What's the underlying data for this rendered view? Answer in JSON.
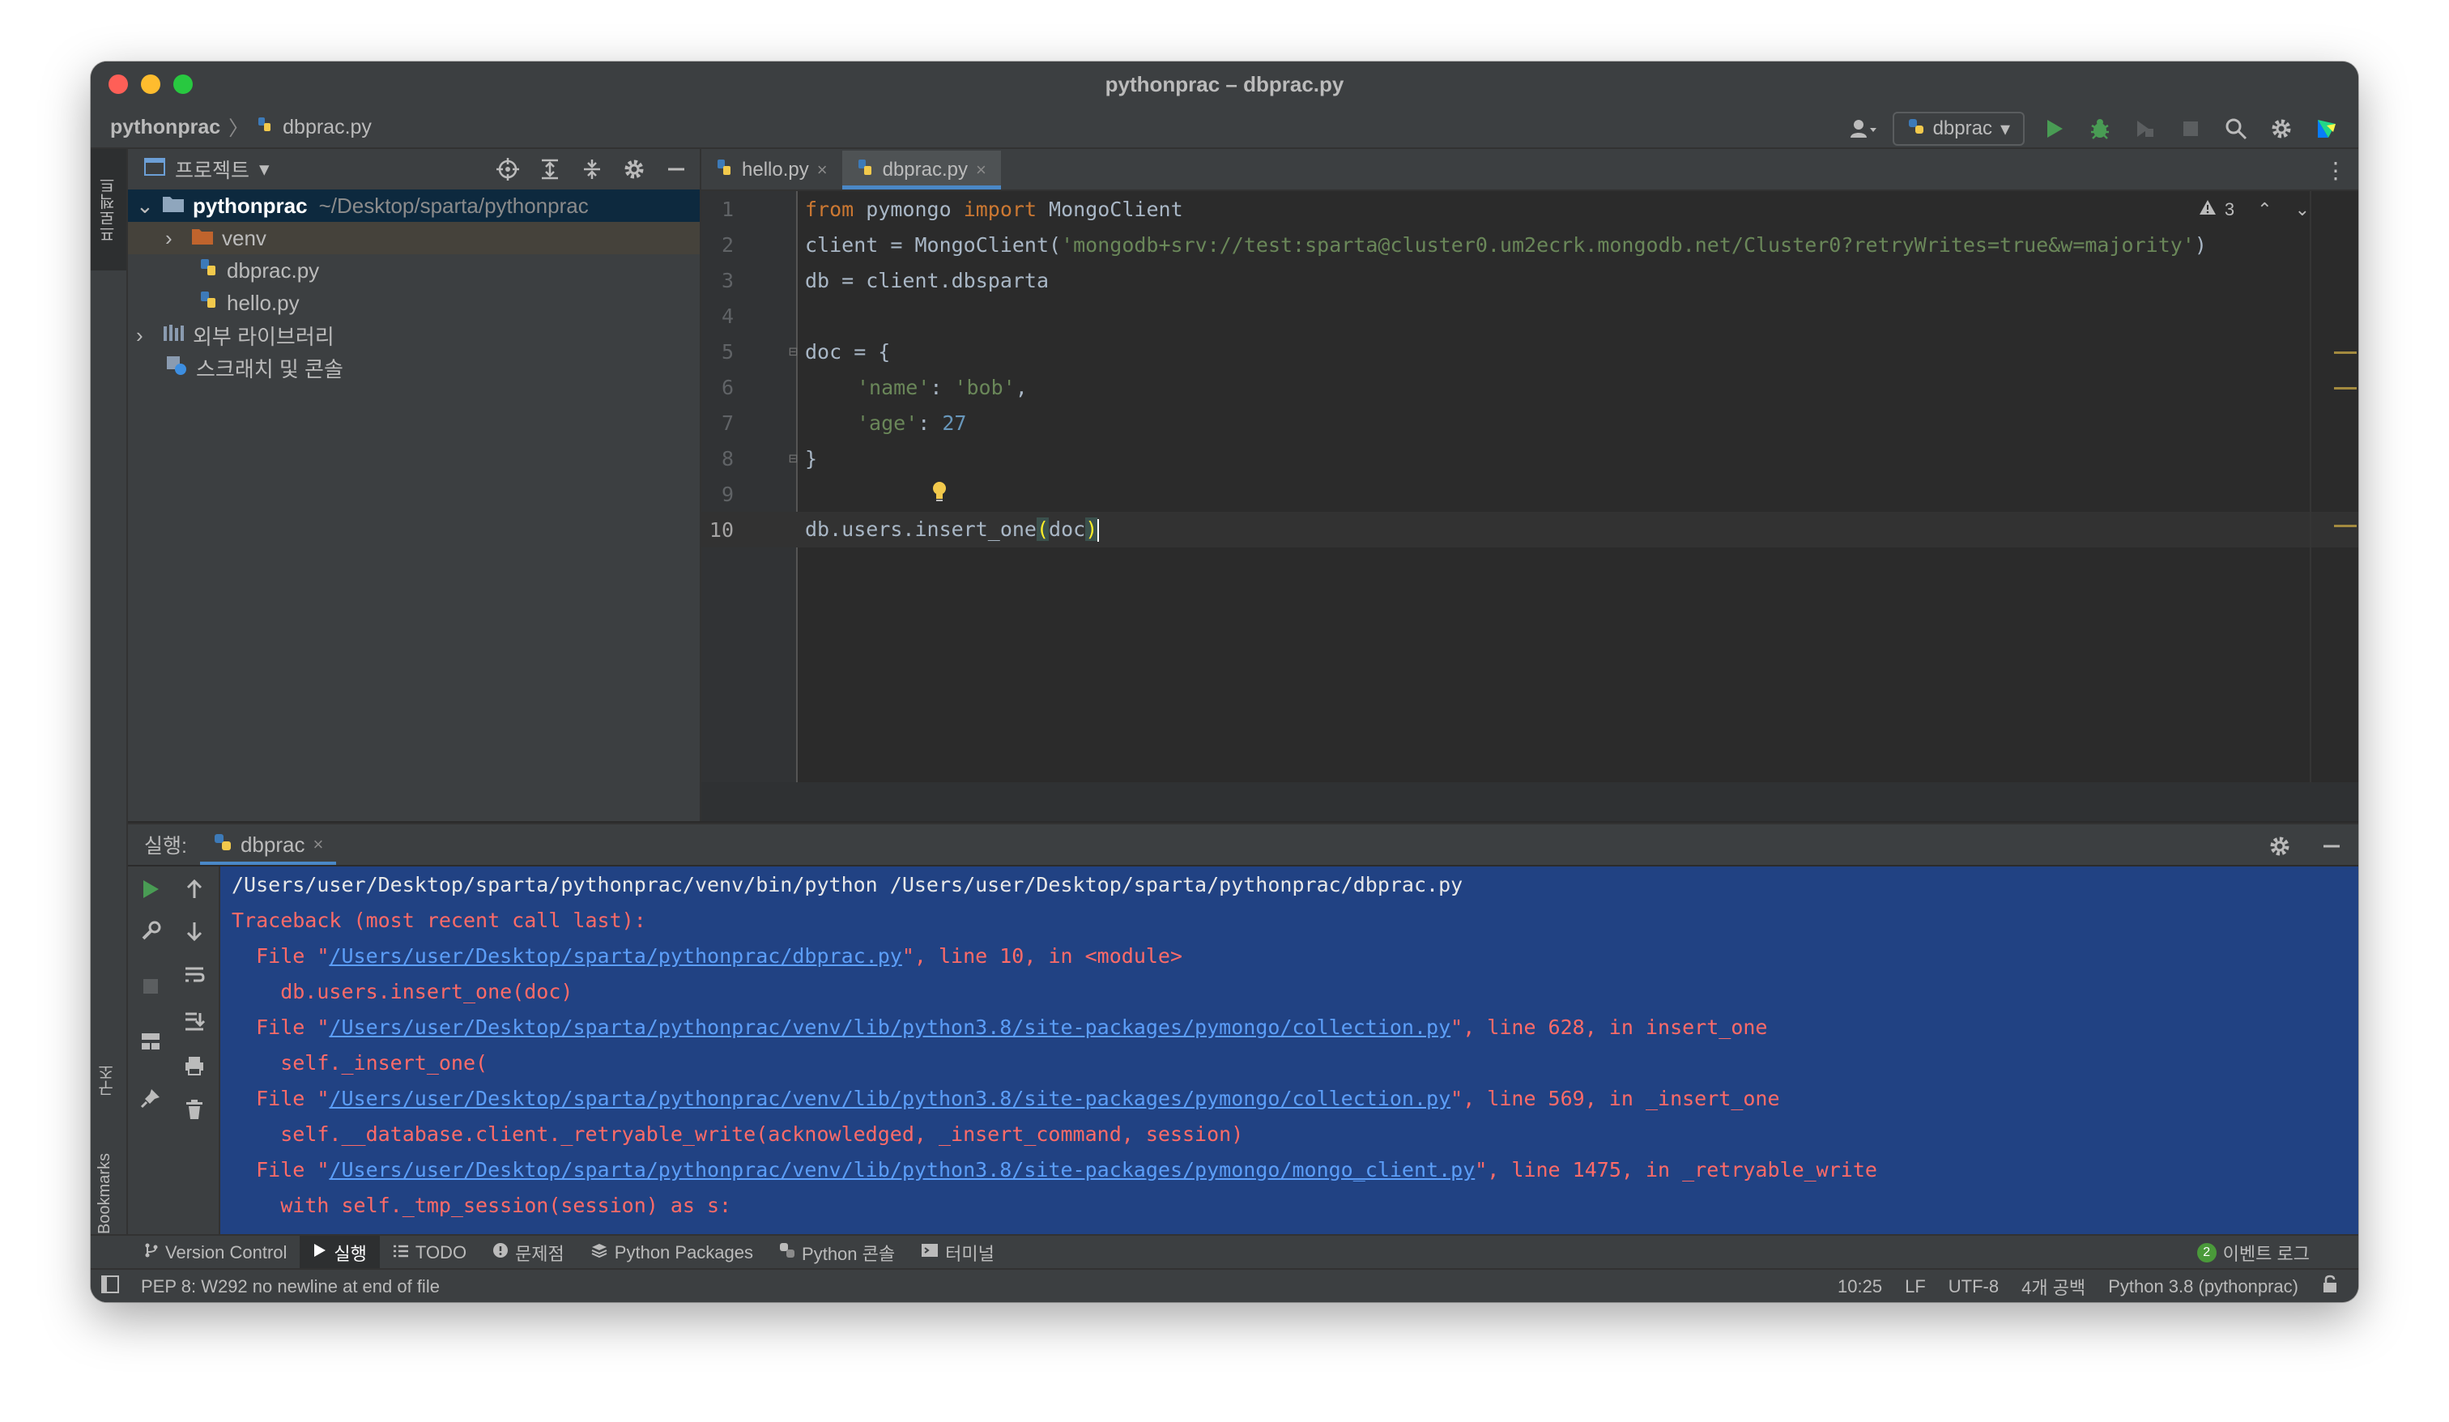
{
  "window": {
    "title": "pythonprac – dbprac.py"
  },
  "navbar": {
    "crumbs": [
      "pythonprac",
      "dbprac.py"
    ],
    "run_config": "dbprac"
  },
  "left_stripe": {
    "project_label": "프로젝트",
    "structure_label": "구조",
    "bookmarks_label": "Bookmarks"
  },
  "project_panel": {
    "title": "프로젝트",
    "root": {
      "name": "pythonprac",
      "path": "~/Desktop/sparta/pythonprac"
    },
    "items": [
      {
        "name": "venv",
        "icon": "folder-icon"
      },
      {
        "name": "dbprac.py",
        "icon": "python-file-icon"
      },
      {
        "name": "hello.py",
        "icon": "python-file-icon"
      },
      {
        "name": "외부 라이브러리",
        "icon": "library-icon"
      },
      {
        "name": "스크래치 및 콘솔",
        "icon": "scratch-icon"
      }
    ]
  },
  "editor": {
    "tabs": [
      {
        "label": "hello.py",
        "active": false
      },
      {
        "label": "dbprac.py",
        "active": true
      }
    ],
    "warning_count": "3",
    "line_numbers": [
      "1",
      "2",
      "3",
      "4",
      "5",
      "6",
      "7",
      "8",
      "9",
      "10"
    ],
    "code": {
      "l1": {
        "kw1": "from",
        "t1": " pymongo ",
        "kw2": "import",
        "t2": " MongoClient"
      },
      "l2": {
        "t1": "client = MongoClient(",
        "s1": "'mongodb+srv://test:sparta@cluster0.um2ecrk.mongodb.net/Cluster0?retryWrites=true&w=majority'",
        "t2": ")"
      },
      "l3": {
        "t1": "db = client.dbsparta"
      },
      "l5": {
        "t1": "doc = {"
      },
      "l6": {
        "s1": "'name'",
        "t1": ": ",
        "s2": "'bob'",
        "t2": ","
      },
      "l7": {
        "s1": "'age'",
        "t1": ": ",
        "n1": "27"
      },
      "l8": {
        "t1": "}"
      },
      "l10": {
        "t1": "db.users.insert_one",
        "b1": "(",
        "t2": "doc",
        "b2": ")"
      }
    }
  },
  "run_panel": {
    "label": "실행:",
    "tab": "dbprac",
    "console": [
      {
        "parts": [
          {
            "text": "/Users/user/Desktop/sparta/pythonprac/venv/bin/python /Users/user/Desktop/sparta/pythonprac/dbprac.py",
            "cls": "c-norm"
          }
        ]
      },
      {
        "parts": [
          {
            "text": "Traceback (most recent call last):",
            "cls": "c-err"
          }
        ]
      },
      {
        "parts": [
          {
            "text": "  File \"",
            "cls": "c-err"
          },
          {
            "text": "/Users/user/Desktop/sparta/pythonprac/dbprac.py",
            "cls": "c-link"
          },
          {
            "text": "\", line 10, in <module>",
            "cls": "c-err"
          }
        ]
      },
      {
        "parts": [
          {
            "text": "    db.users.insert_one(doc)",
            "cls": "c-err"
          }
        ]
      },
      {
        "parts": [
          {
            "text": "  File \"",
            "cls": "c-err"
          },
          {
            "text": "/Users/user/Desktop/sparta/pythonprac/venv/lib/python3.8/site-packages/pymongo/collection.py",
            "cls": "c-link"
          },
          {
            "text": "\", line 628, in insert_one",
            "cls": "c-err"
          }
        ]
      },
      {
        "parts": [
          {
            "text": "    self._insert_one(",
            "cls": "c-err"
          }
        ]
      },
      {
        "parts": [
          {
            "text": "  File \"",
            "cls": "c-err"
          },
          {
            "text": "/Users/user/Desktop/sparta/pythonprac/venv/lib/python3.8/site-packages/pymongo/collection.py",
            "cls": "c-link"
          },
          {
            "text": "\", line 569, in _insert_one",
            "cls": "c-err"
          }
        ]
      },
      {
        "parts": [
          {
            "text": "    self.__database.client._retryable_write(acknowledged, _insert_command, session)",
            "cls": "c-err"
          }
        ]
      },
      {
        "parts": [
          {
            "text": "  File \"",
            "cls": "c-err"
          },
          {
            "text": "/Users/user/Desktop/sparta/pythonprac/venv/lib/python3.8/site-packages/pymongo/mongo_client.py",
            "cls": "c-link"
          },
          {
            "text": "\", line 1475, in _retryable_write",
            "cls": "c-err"
          }
        ]
      },
      {
        "parts": [
          {
            "text": "    with self._tmp_session(session) as s:",
            "cls": "c-err"
          }
        ]
      }
    ]
  },
  "bottom_toolbar": {
    "items": [
      {
        "label": "Version Control",
        "icon": "branch-icon",
        "active": false
      },
      {
        "label": "실행",
        "icon": "run-icon",
        "active": true
      },
      {
        "label": "TODO",
        "icon": "list-icon",
        "active": false
      },
      {
        "label": "문제점",
        "icon": "problems-icon",
        "active": false
      },
      {
        "label": "Python Packages",
        "icon": "layers-icon",
        "active": false
      },
      {
        "label": "Python 콘솔",
        "icon": "python-icon",
        "active": false
      },
      {
        "label": "터미널",
        "icon": "terminal-icon",
        "active": false
      }
    ],
    "events_count": "2",
    "events_label": "이벤트 로그"
  },
  "statusbar": {
    "message": "PEP 8: W292 no newline at end of file",
    "position": "10:25",
    "line_sep": "LF",
    "encoding": "UTF-8",
    "indent": "4개 공백",
    "interpreter": "Python 3.8 (pythonprac)"
  },
  "colors": {
    "accent": "#4a88c7",
    "console_bg": "#214283",
    "error": "#ff6b68",
    "keyword": "#cc7832",
    "string": "#6a8759",
    "number": "#6897bb"
  }
}
